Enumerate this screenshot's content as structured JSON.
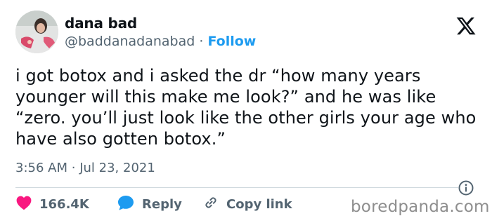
{
  "author": {
    "display_name": "dana bad",
    "handle": "@baddanadanabad",
    "separator": "·",
    "follow_label": "Follow",
    "avatar_icon": "profile-photo"
  },
  "platform_icon": "x-logo-icon",
  "tweet": {
    "text": "i got botox and i asked the dr “how many years younger will this make me look?” and he was like “zero. you’ll just look like the other girls your age who have also gotten botox.”",
    "time": "3:56 AM",
    "date_separator": "·",
    "date": "Jul 23, 2021"
  },
  "actions": {
    "like_count": "166.4K",
    "reply_label": "Reply",
    "copy_link_label": "Copy link"
  },
  "watermark": "boredpanda.com",
  "colors": {
    "accent": "#1d9bf0",
    "like": "#f91880",
    "text": "#0f1419",
    "muted": "#536471",
    "divider": "#cfd9de"
  }
}
